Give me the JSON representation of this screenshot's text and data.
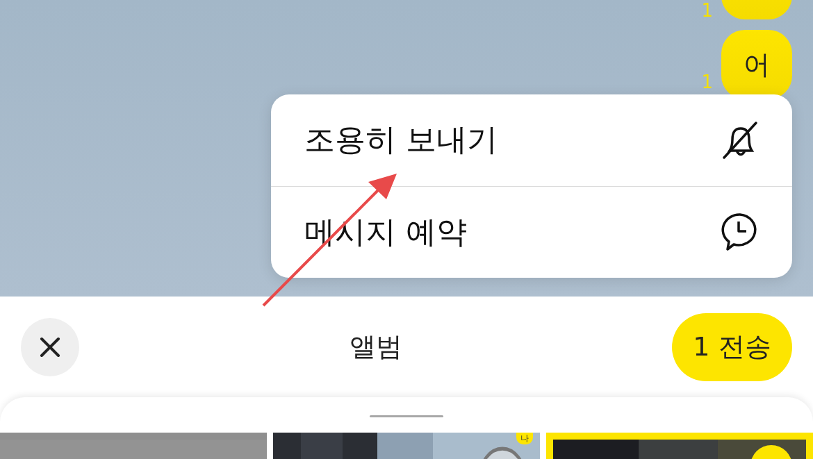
{
  "chat": {
    "messages": [
      {
        "unread": "1"
      },
      {
        "unread": "1",
        "text": "어"
      }
    ]
  },
  "context_menu": {
    "items": [
      {
        "label": "조용히 보내기",
        "kind": "silent"
      },
      {
        "label": "메시지 예약",
        "kind": "schedule"
      }
    ]
  },
  "header": {
    "title": "앨범",
    "send_button": "1 전송"
  },
  "album": {
    "photos": [
      {
        "kind": "picture",
        "selected": false
      },
      {
        "kind": "picture",
        "selected": false,
        "badge": "나"
      },
      {
        "kind": "picture",
        "selected": true
      }
    ]
  }
}
